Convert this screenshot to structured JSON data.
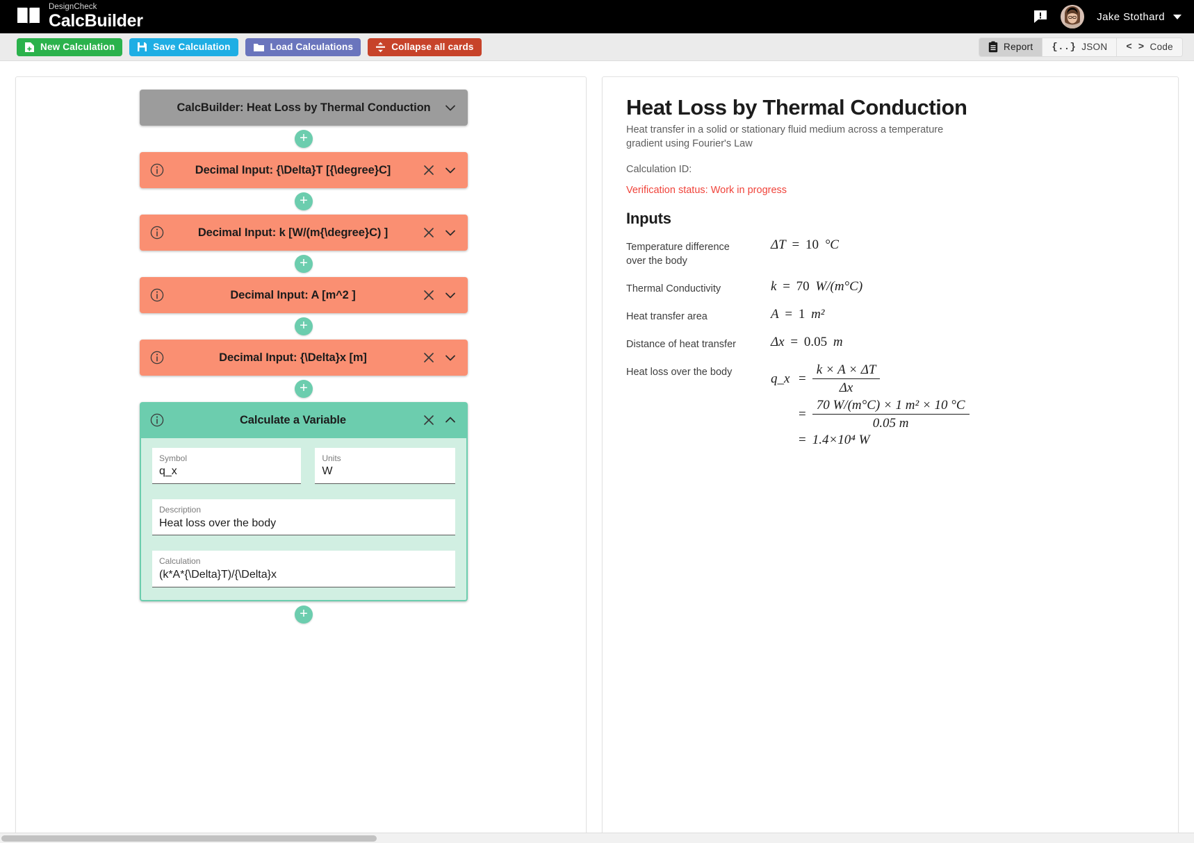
{
  "header": {
    "brand_sub": "DesignCheck",
    "brand_main": "CalcBuilder",
    "feedback_icon": "feedback-speech-bubble-icon",
    "user_name": "Jake Stothard",
    "user_caret_icon": "caret-down-icon"
  },
  "toolbar": {
    "new_calculation": "New Calculation",
    "save_calculation": "Save Calculation",
    "load_calculations": "Load Calculations",
    "collapse_all": "Collapse all cards",
    "views": [
      {
        "label": "Report",
        "icon": "clipboard-icon",
        "active": true
      },
      {
        "label": "JSON",
        "icon": "curly-braces-icon",
        "glyph": "{..}",
        "active": false
      },
      {
        "label": "Code",
        "icon": "angle-brackets-icon",
        "glyph": "< >",
        "active": false
      }
    ]
  },
  "colors": {
    "new_calculation": "#2bb24c",
    "save_calculation": "#1eaee4",
    "load_calculations": "#6a75bd",
    "collapse_all": "#c7432a",
    "header_card": "#9c9c9c",
    "input_card": "#fa8f72",
    "calc_card": "#6ccdae",
    "calc_card_body": "#d1efe2",
    "status_warning": "#f0433a"
  },
  "cards": {
    "root": {
      "title": "CalcBuilder: Heat Loss by Thermal Conduction",
      "chevron": "chevron-down-icon"
    },
    "items": [
      {
        "title": "Decimal Input: {\\Delta}T [{\\degree}C]",
        "type": "decimal-input"
      },
      {
        "title": "Decimal Input: k [W/(m{\\degree}C) ]",
        "type": "decimal-input"
      },
      {
        "title": "Decimal Input: A [m^2 ]",
        "type": "decimal-input"
      },
      {
        "title": "Decimal Input: {\\Delta}x [m]",
        "type": "decimal-input"
      }
    ],
    "calculate": {
      "title": "Calculate a Variable",
      "fields": {
        "symbol_label": "Symbol",
        "symbol_value": "q_x",
        "units_label": "Units",
        "units_value": "W",
        "description_label": "Description",
        "description_value": "Heat loss over the body",
        "calculation_label": "Calculation",
        "calculation_value": "(k*A*{\\Delta}T)/{\\Delta}x"
      }
    },
    "add_button_label": "+"
  },
  "report": {
    "title": "Heat Loss by Thermal Conduction",
    "description": "Heat transfer in a solid or stationary fluid medium across a temperature gradient using Fourier's Law",
    "calculation_id": "Calculation ID:",
    "verification_status": "Verification status: Work in progress",
    "inputs_heading": "Inputs",
    "inputs": [
      {
        "label": "Temperature difference over the body",
        "symbol": "ΔT",
        "value": "10",
        "units": "°C"
      },
      {
        "label": "Thermal Conductivity",
        "symbol": "k",
        "value": "70",
        "units": "W/(m°C)"
      },
      {
        "label": "Heat transfer area",
        "symbol": "A",
        "value": "1",
        "units": "m²"
      },
      {
        "label": "Distance of heat transfer",
        "symbol": "Δx",
        "value": "0.05",
        "units": "m"
      }
    ],
    "result": {
      "label": "Heat loss over the body",
      "symbol": "q_x",
      "symbolic_numerator": "k × A × ΔT",
      "symbolic_denominator": "Δx",
      "numeric_numerator": "70 W/(m°C) × 1 m² × 10 °C",
      "numeric_denominator": "0.05 m",
      "final_value": "1.4×10⁴ W"
    }
  }
}
